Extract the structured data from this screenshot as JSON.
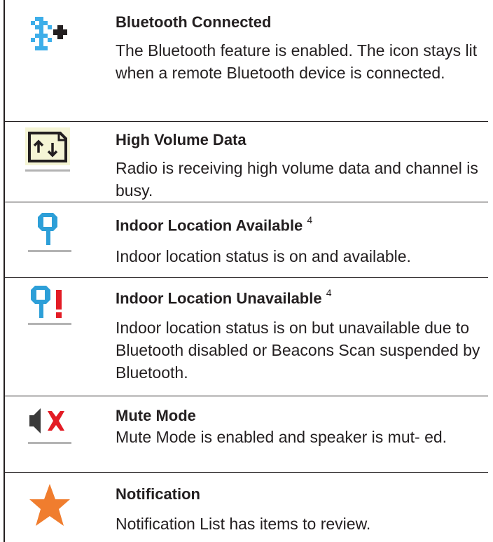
{
  "items": [
    {
      "icon": "bluetooth-connected-icon",
      "title": "Bluetooth Connected",
      "sup": "",
      "desc": "The Bluetooth feature is enabled. The icon stays lit when a remote Bluetooth device is connected."
    },
    {
      "icon": "high-volume-data-icon",
      "title": "High Volume Data",
      "sup": "",
      "desc": "Radio is receiving high volume data and channel is busy."
    },
    {
      "icon": "indoor-location-available-icon",
      "title": "Indoor Location Available",
      "sup": "4",
      "desc": "Indoor location status is on and available."
    },
    {
      "icon": "indoor-location-unavailable-icon",
      "title": "Indoor Location Unavailable",
      "sup": "4",
      "desc": "Indoor location status is on but unavailable due to Bluetooth disabled or Beacons Scan suspended by Bluetooth."
    },
    {
      "icon": "mute-mode-icon",
      "title": "Mute Mode",
      "sup": "",
      "desc": "Mute Mode is enabled and speaker is mut- ed."
    },
    {
      "icon": "notification-star-icon",
      "title": "Notification",
      "sup": "",
      "desc": "Notification List has items to review."
    }
  ],
  "colors": {
    "bluetooth": "#3daee9",
    "location": "#2d9fd8",
    "mute_x": "#e31c25",
    "notification": "#f07d2e",
    "divider": "#b3b3b3"
  }
}
